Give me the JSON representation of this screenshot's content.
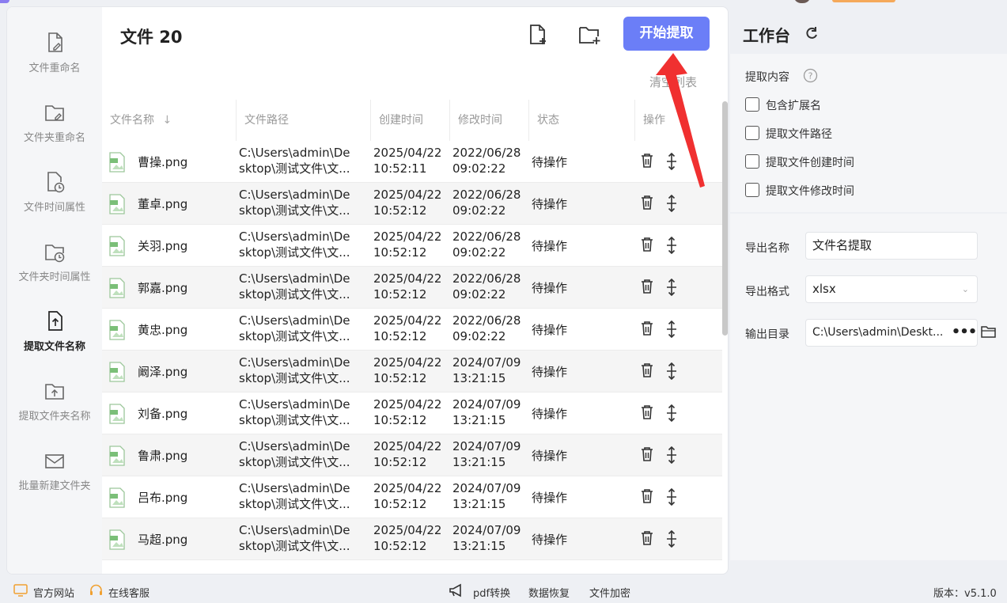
{
  "sidebar": {
    "items": [
      {
        "label": "文件重命名",
        "icon": "file-edit-icon"
      },
      {
        "label": "文件夹重命名",
        "icon": "folder-edit-icon"
      },
      {
        "label": "文件时间属性",
        "icon": "file-clock-icon"
      },
      {
        "label": "文件夹时间属性",
        "icon": "folder-clock-icon"
      },
      {
        "label": "提取文件名称",
        "icon": "file-upload-icon",
        "active": true
      },
      {
        "label": "提取文件夹名称",
        "icon": "folder-upload-icon"
      },
      {
        "label": "批量新建文件夹",
        "icon": "mail-folder-icon"
      }
    ]
  },
  "header": {
    "title": "文件 20",
    "start_label": "开始提取",
    "clear_label": "清空列表",
    "accent": "#6b7ef7"
  },
  "table": {
    "columns": [
      "文件名称",
      "文件路径",
      "创建时间",
      "修改时间",
      "状态",
      "操作"
    ],
    "rows": [
      {
        "name": "曹操.png",
        "path1": "C:\\Users\\admin\\De",
        "path2": "sktop\\测试文件\\文...",
        "c1": "2025/04/22",
        "c2": "10:52:11",
        "m1": "2022/06/28",
        "m2": "09:02:22",
        "status": "待操作"
      },
      {
        "name": "董卓.png",
        "path1": "C:\\Users\\admin\\De",
        "path2": "sktop\\测试文件\\文...",
        "c1": "2025/04/22",
        "c2": "10:52:12",
        "m1": "2022/06/28",
        "m2": "09:02:22",
        "status": "待操作"
      },
      {
        "name": "关羽.png",
        "path1": "C:\\Users\\admin\\De",
        "path2": "sktop\\测试文件\\文...",
        "c1": "2025/04/22",
        "c2": "10:52:12",
        "m1": "2022/06/28",
        "m2": "09:02:22",
        "status": "待操作"
      },
      {
        "name": "郭嘉.png",
        "path1": "C:\\Users\\admin\\De",
        "path2": "sktop\\测试文件\\文...",
        "c1": "2025/04/22",
        "c2": "10:52:12",
        "m1": "2022/06/28",
        "m2": "09:02:22",
        "status": "待操作"
      },
      {
        "name": "黄忠.png",
        "path1": "C:\\Users\\admin\\De",
        "path2": "sktop\\测试文件\\文...",
        "c1": "2025/04/22",
        "c2": "10:52:12",
        "m1": "2022/06/28",
        "m2": "09:02:22",
        "status": "待操作"
      },
      {
        "name": "阚泽.png",
        "path1": "C:\\Users\\admin\\De",
        "path2": "sktop\\测试文件\\文...",
        "c1": "2025/04/22",
        "c2": "10:52:12",
        "m1": "2024/07/09",
        "m2": "13:21:15",
        "status": "待操作"
      },
      {
        "name": "刘备.png",
        "path1": "C:\\Users\\admin\\De",
        "path2": "sktop\\测试文件\\文...",
        "c1": "2025/04/22",
        "c2": "10:52:12",
        "m1": "2024/07/09",
        "m2": "13:21:15",
        "status": "待操作"
      },
      {
        "name": "鲁肃.png",
        "path1": "C:\\Users\\admin\\De",
        "path2": "sktop\\测试文件\\文...",
        "c1": "2025/04/22",
        "c2": "10:52:12",
        "m1": "2024/07/09",
        "m2": "13:21:15",
        "status": "待操作"
      },
      {
        "name": "吕布.png",
        "path1": "C:\\Users\\admin\\De",
        "path2": "sktop\\测试文件\\文...",
        "c1": "2025/04/22",
        "c2": "10:52:12",
        "m1": "2024/07/09",
        "m2": "13:21:15",
        "status": "待操作"
      },
      {
        "name": "马超.png",
        "path1": "C:\\Users\\admin\\De",
        "path2": "sktop\\测试文件\\文...",
        "c1": "2025/04/22",
        "c2": "10:52:12",
        "m1": "2024/07/09",
        "m2": "13:21:15",
        "status": "待操作"
      }
    ]
  },
  "workbench": {
    "title": "工作台",
    "extract_label": "提取内容",
    "options": [
      {
        "label": "包含扩展名",
        "checked": false
      },
      {
        "label": "提取文件路径",
        "checked": false
      },
      {
        "label": "提取文件创建时间",
        "checked": false
      },
      {
        "label": "提取文件修改时间",
        "checked": false
      }
    ],
    "export_name_label": "导出名称",
    "export_name_value": "文件名提取",
    "export_format_label": "导出格式",
    "export_format_value": "xlsx",
    "output_dir_label": "输出目录",
    "output_dir_value": "C:\\Users\\admin\\Deskt...",
    "dots": "•••"
  },
  "footer": {
    "website": "官方网站",
    "support": "在线客服",
    "pdf": "pdf转换",
    "recovery": "数据恢复",
    "encrypt": "文件加密",
    "version": "版本：v5.1.0"
  }
}
